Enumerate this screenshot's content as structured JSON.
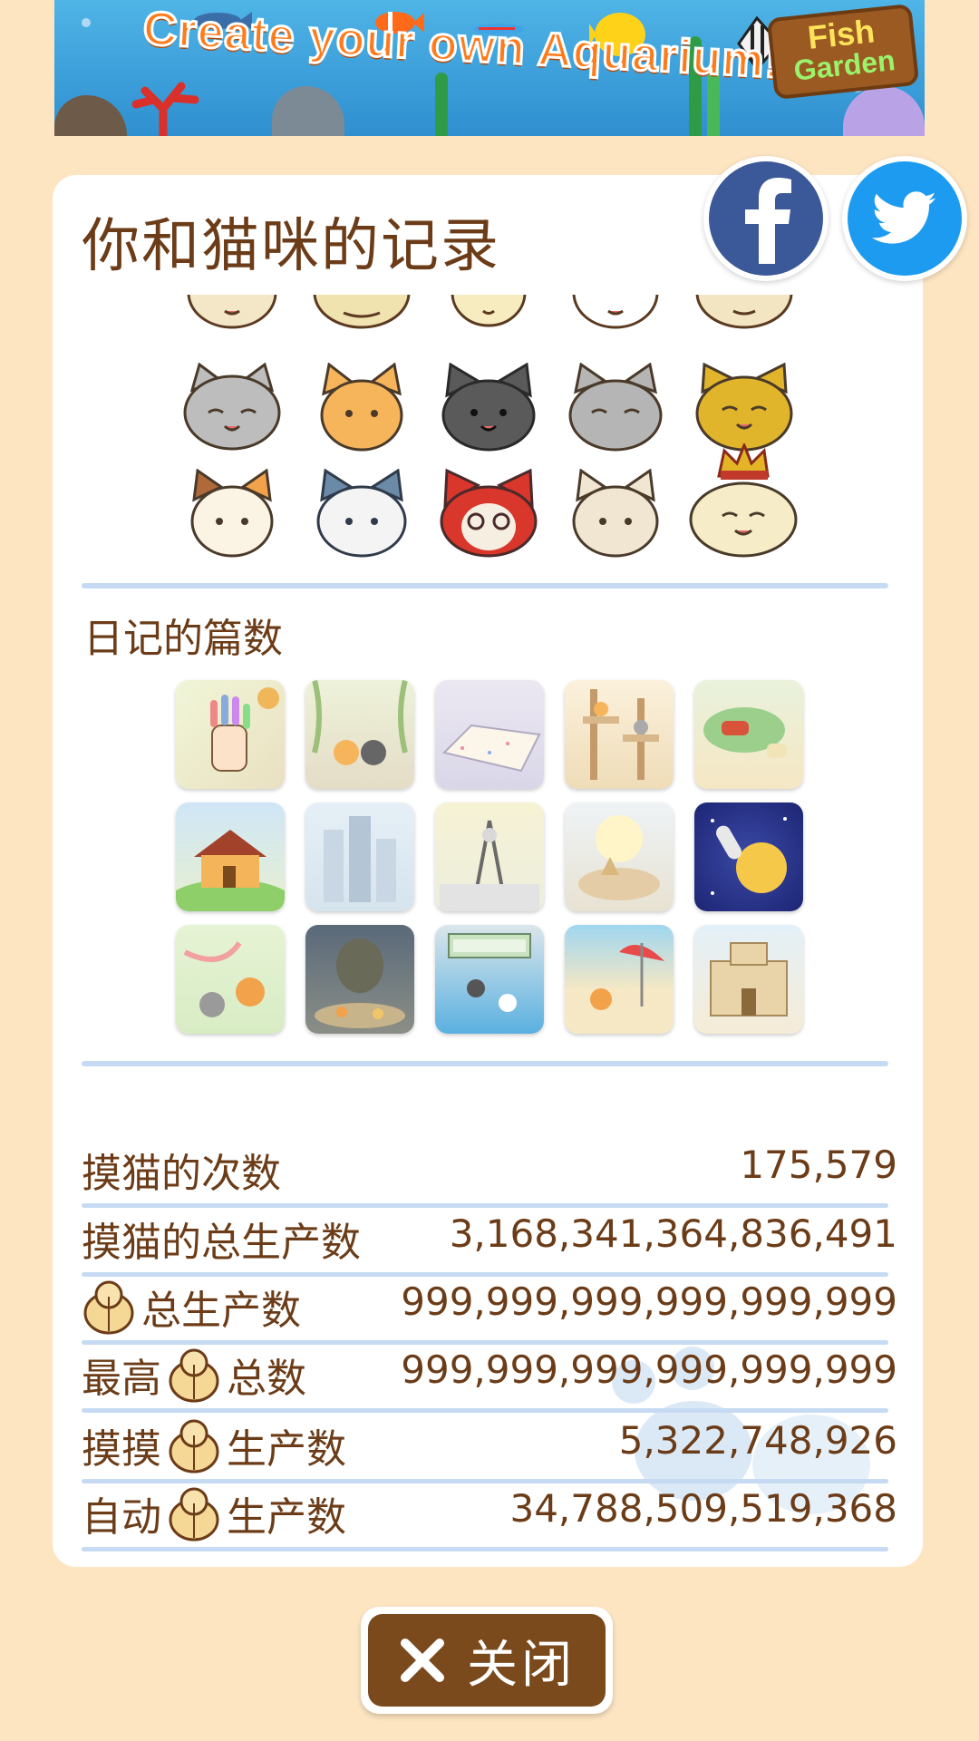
{
  "ad": {
    "headline": "Create your own Aquarium!",
    "logo_line1": "Fish",
    "logo_line2": "Garden"
  },
  "card": {
    "title": "你和猫咪的记录"
  },
  "social": {
    "facebook": "facebook-icon",
    "twitter": "twitter-icon"
  },
  "diary": {
    "label": "日记的篇数"
  },
  "stats": [
    {
      "label": "摸猫的次数",
      "value": "175,579"
    },
    {
      "label": "摸猫的总生产数",
      "value": "3,168,341,364,836,491"
    },
    {
      "prefix": "",
      "suffix": "总生产数",
      "value": "999,999,999,999,999,999"
    },
    {
      "prefix": "最高",
      "suffix": "总数",
      "value": "999,999,999,999,999,999"
    },
    {
      "prefix": "摸摸",
      "suffix": "生产数",
      "value": "5,322,748,926"
    },
    {
      "prefix": "自动",
      "suffix": "生产数",
      "value": "34,788,509,519,368"
    }
  ],
  "close_button": {
    "label": "关闭"
  },
  "colors": {
    "background": "#fde5c2",
    "brown": "#6b3c17",
    "button": "#7a4a1d",
    "divider": "#c6dbf3"
  }
}
